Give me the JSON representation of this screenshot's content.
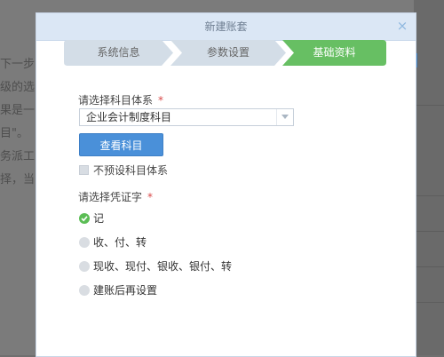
{
  "background": {
    "page_text_lines": [
      "下一步",
      "级的选",
      "果是一",
      "目\"。",
      "务派工",
      "择，当"
    ]
  },
  "dialog": {
    "title": "新建账套",
    "close_label": "×",
    "steps": [
      {
        "label": "系统信息",
        "state": "done"
      },
      {
        "label": "参数设置",
        "state": "done"
      },
      {
        "label": "基础资料",
        "state": "active"
      }
    ],
    "account_system": {
      "label": "请选择科目体系",
      "required_mark": "*",
      "selected": "企业会计制度科目",
      "view_button": "查看科目",
      "no_preset_label": "不预设科目体系",
      "no_preset_checked": false
    },
    "voucher": {
      "label": "请选择凭证字",
      "required_mark": "*",
      "options": [
        {
          "label": "记",
          "checked": true
        },
        {
          "label": "收、付、转",
          "checked": false
        },
        {
          "label": "现收、现付、银收、银付、转",
          "checked": false
        },
        {
          "label": "建账后再设置",
          "checked": false
        }
      ]
    }
  },
  "colors": {
    "step_inactive": "#d3dde7",
    "step_active": "#67bf63",
    "primary_button": "#4a90d9",
    "required": "#d94a4a"
  }
}
